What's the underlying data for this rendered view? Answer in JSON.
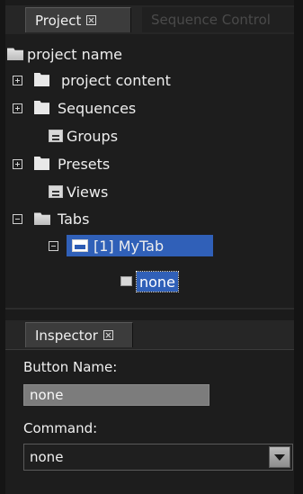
{
  "project_panel": {
    "tab_label": "Project",
    "other_tab_label": "Sequence Control"
  },
  "tree": {
    "root": "project name",
    "items": [
      {
        "label": "project content",
        "icon": "folder-icon"
      },
      {
        "label": "Sequences",
        "icon": "sequences-icon"
      },
      {
        "label": "Groups",
        "icon": "groups-icon"
      },
      {
        "label": "Presets",
        "icon": "presets-icon"
      },
      {
        "label": "Views",
        "icon": "views-icon"
      },
      {
        "label": "Tabs",
        "icon": "tabs-icon"
      }
    ],
    "selected_tab": "[1] MyTab",
    "selected_button": "none"
  },
  "inspector": {
    "tab_label": "Inspector",
    "button_name_label": "Button Name:",
    "button_name_value": "none",
    "command_label": "Command:",
    "command_value": "none"
  }
}
